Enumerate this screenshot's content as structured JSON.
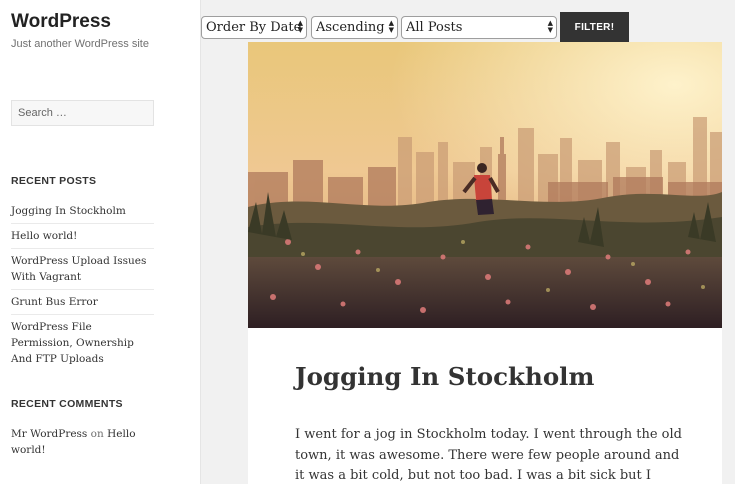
{
  "site": {
    "title": "WordPress",
    "tagline": "Just another WordPress site"
  },
  "search": {
    "placeholder": "Search …"
  },
  "recent_posts": {
    "heading": "RECENT POSTS",
    "items": [
      "Jogging In Stockholm",
      "Hello world!",
      "WordPress Upload Issues With Vagrant",
      "Grunt Bus Error",
      "WordPress File Permission, Ownership And FTP Uploads"
    ]
  },
  "recent_comments": {
    "heading": "RECENT COMMENTS",
    "author": "Mr WordPress",
    "on": "on",
    "post": "Hello world!"
  },
  "filter": {
    "order_by": "Order By Date",
    "direction": "Ascending",
    "category": "All Posts",
    "button": "FILTER!"
  },
  "article": {
    "title": "Jogging In Stockholm",
    "excerpt": "I went for a jog in Stockholm today. I went through the old town, it was awesome. There were few people around and it was a bit cold, but not too bad. I was a bit sick but I decided to run anyway"
  },
  "colors": {
    "filter_button": "#333333",
    "sidebar_bg": "#ffffff",
    "page_bg": "#f1f1f1"
  }
}
